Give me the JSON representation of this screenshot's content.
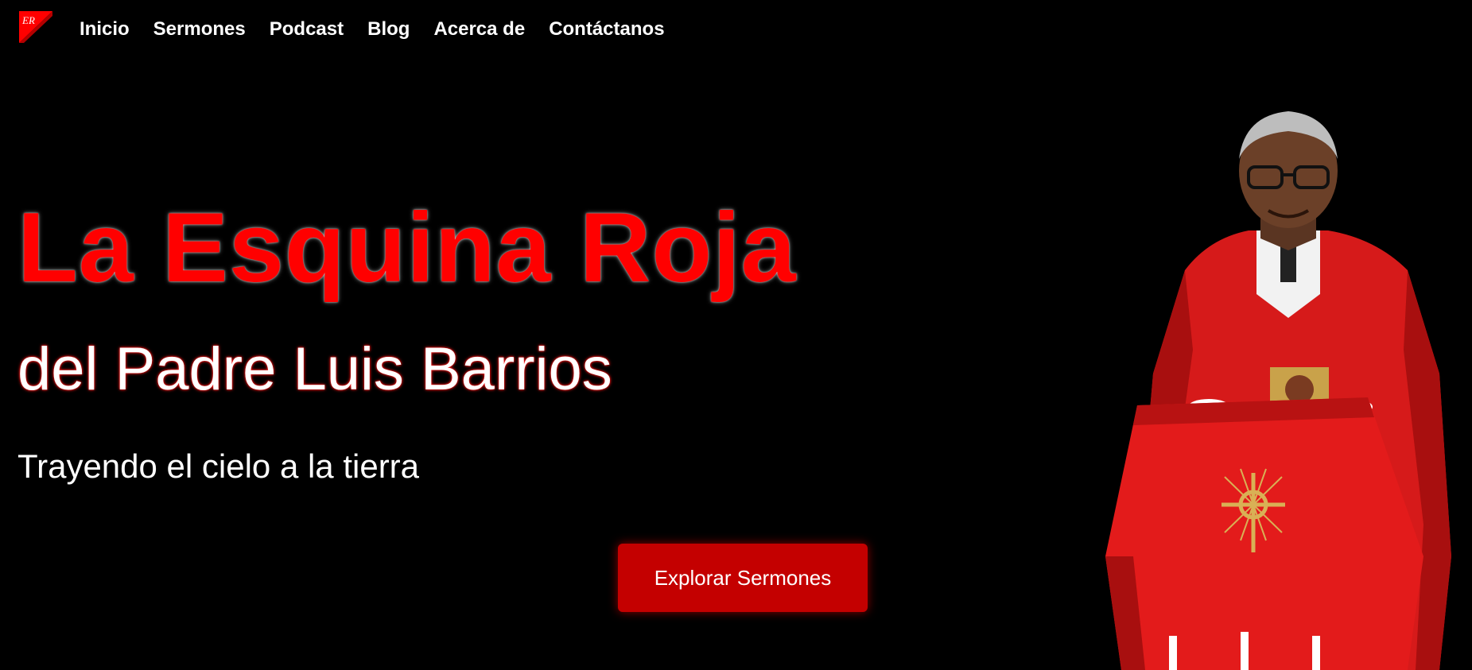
{
  "brand": {
    "logo_text": "ER",
    "logo_color": "#ff0000"
  },
  "nav": {
    "items": [
      {
        "label": "Inicio"
      },
      {
        "label": "Sermones"
      },
      {
        "label": "Podcast"
      },
      {
        "label": "Blog"
      },
      {
        "label": "Acerca de"
      },
      {
        "label": "Contáctanos"
      }
    ]
  },
  "hero": {
    "title": "La Esquina Roja",
    "subtitle": "del Padre Luis Barrios",
    "tagline": "Trayendo el cielo a la tierra",
    "cta_label": "Explorar Sermones"
  },
  "colors": {
    "background": "#000000",
    "accent": "#ff0000",
    "button": "#c40000",
    "text": "#ffffff"
  },
  "image": {
    "icon": "priest-photo"
  }
}
